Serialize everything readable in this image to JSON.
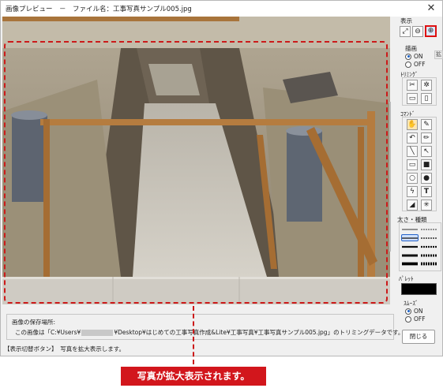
{
  "window": {
    "title": "画像プレビュー　－　ファイル名：工事写真サンプル005.jpg",
    "close_glyph": "✕"
  },
  "save": {
    "label": "画像の保存場所:",
    "path_prefix": "この画像は「C:¥Users¥",
    "path_suffix": "¥Desktop¥はじめての工事写真作成&Lite¥工事写真¥工事写真サンプル005.jpg」のトリミングデータです。"
  },
  "status": {
    "text": "【表示切替ボタン】　写真を拡大表示します。"
  },
  "panel": {
    "display_title": "表示",
    "side_tab": "拡大",
    "draw_title": "描画",
    "draw_on": "ON",
    "draw_off": "OFF",
    "draw_selected": "ON",
    "trim_title": "ﾄﾘﾐﾝｸﾞ",
    "command_title": "ｺﾏﾝﾄﾞ",
    "command_t": "T",
    "thickness_title": "太さ・種類",
    "palette_title": "ﾊﾟﾚｯﾄ",
    "palette_color": "#000000",
    "smooth_title": "ｽﾑｰｽﾞ",
    "smooth_on": "ON",
    "smooth_off": "OFF",
    "smooth_selected": "ON",
    "close_button": "閉じる"
  },
  "icons": {
    "fit": "fit-window-icon",
    "zoom_out": "zoom-out-icon",
    "zoom_in": "zoom-in-icon"
  },
  "callout": {
    "text": "写真が拡大表示されます。",
    "color": "#d2161c"
  }
}
